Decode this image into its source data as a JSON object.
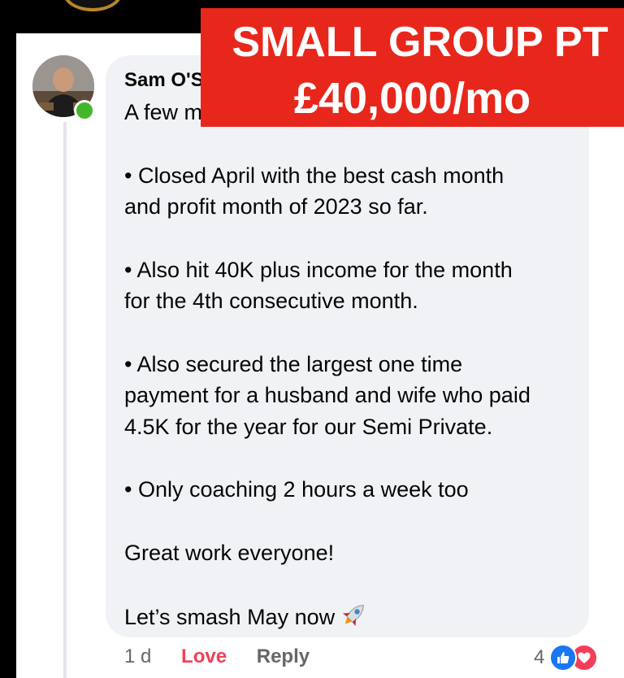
{
  "banner": {
    "title": "SMALL GROUP PT",
    "subtitle": "£40,000/mo"
  },
  "comment": {
    "author": "Sam O'S",
    "intro": "A few m",
    "lines": [
      "• Closed April with the best cash month",
      "and profit month of 2023 so far.",
      "• Also hit 40K plus income for the month",
      "for the 4th consecutive month.",
      "• Also secured the largest one time",
      "payment for a husband and wife who paid",
      "4.5K for the year for our Semi Private.",
      "• Only coaching 2 hours a week too",
      "Great work everyone!",
      "Let’s smash May now"
    ],
    "emoji_icon": "rocket-icon"
  },
  "actions": {
    "time": "1 d",
    "love": "Love",
    "reply": "Reply"
  },
  "reactions": {
    "count": "4",
    "icons": [
      "like-icon",
      "heart-icon"
    ]
  },
  "colors": {
    "banner": "#e8271c",
    "bubble": "#f0f2f5",
    "love": "#f33e58",
    "like": "#1877f2",
    "online": "#42b72a",
    "muted": "#65676b"
  }
}
